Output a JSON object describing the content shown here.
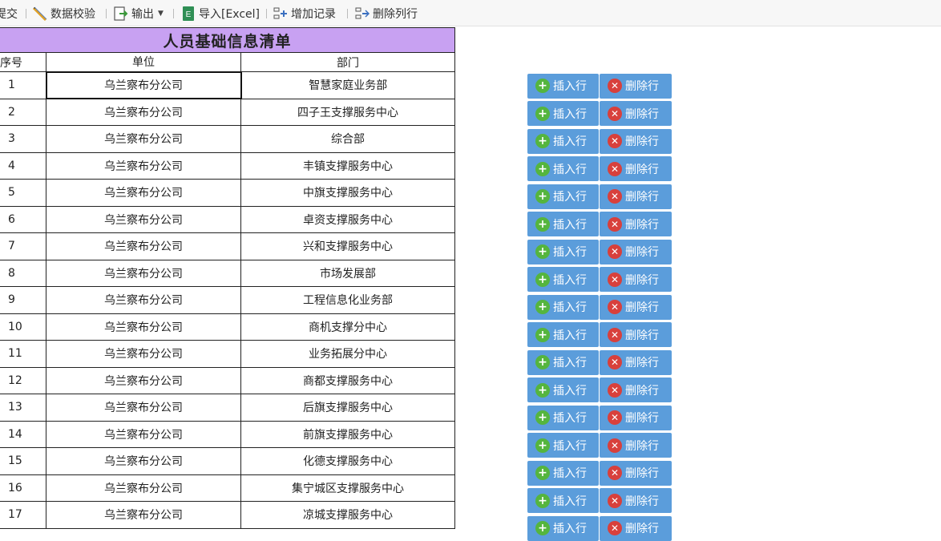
{
  "toolbar": {
    "submit_label": "提交",
    "validate_label": "数据校验",
    "export_label": "输出",
    "import_label": "导入[Excel]",
    "add_record_label": "增加记录",
    "delete_row_label": "删除列行"
  },
  "sheet": {
    "title": "人员基础信息清单",
    "columns": [
      "序号",
      "单位",
      "部门"
    ],
    "rows": [
      {
        "seq": "1",
        "unit": "乌兰察布分公司",
        "dept": "智慧家庭业务部"
      },
      {
        "seq": "2",
        "unit": "乌兰察布分公司",
        "dept": "四子王支撑服务中心"
      },
      {
        "seq": "3",
        "unit": "乌兰察布分公司",
        "dept": "综合部"
      },
      {
        "seq": "4",
        "unit": "乌兰察布分公司",
        "dept": "丰镇支撑服务中心"
      },
      {
        "seq": "5",
        "unit": "乌兰察布分公司",
        "dept": "中旗支撑服务中心"
      },
      {
        "seq": "6",
        "unit": "乌兰察布分公司",
        "dept": "卓资支撑服务中心"
      },
      {
        "seq": "7",
        "unit": "乌兰察布分公司",
        "dept": "兴和支撑服务中心"
      },
      {
        "seq": "8",
        "unit": "乌兰察布分公司",
        "dept": "市场发展部"
      },
      {
        "seq": "9",
        "unit": "乌兰察布分公司",
        "dept": "工程信息化业务部"
      },
      {
        "seq": "10",
        "unit": "乌兰察布分公司",
        "dept": "商机支撑分中心"
      },
      {
        "seq": "11",
        "unit": "乌兰察布分公司",
        "dept": "业务拓展分中心"
      },
      {
        "seq": "12",
        "unit": "乌兰察布分公司",
        "dept": "商都支撑服务中心"
      },
      {
        "seq": "13",
        "unit": "乌兰察布分公司",
        "dept": "后旗支撑服务中心"
      },
      {
        "seq": "14",
        "unit": "乌兰察布分公司",
        "dept": "前旗支撑服务中心"
      },
      {
        "seq": "15",
        "unit": "乌兰察布分公司",
        "dept": "化德支撑服务中心"
      },
      {
        "seq": "16",
        "unit": "乌兰察布分公司",
        "dept": "集宁城区支撑服务中心"
      },
      {
        "seq": "17",
        "unit": "乌兰察布分公司",
        "dept": "凉城支撑服务中心"
      }
    ]
  },
  "actions": {
    "insert_label": "插入行",
    "delete_label": "删除行"
  },
  "colors": {
    "title_bg": "#c8a1f2",
    "button_bg": "#5b9ddb",
    "insert_icon": "#55b53e",
    "delete_icon": "#d8403c"
  }
}
